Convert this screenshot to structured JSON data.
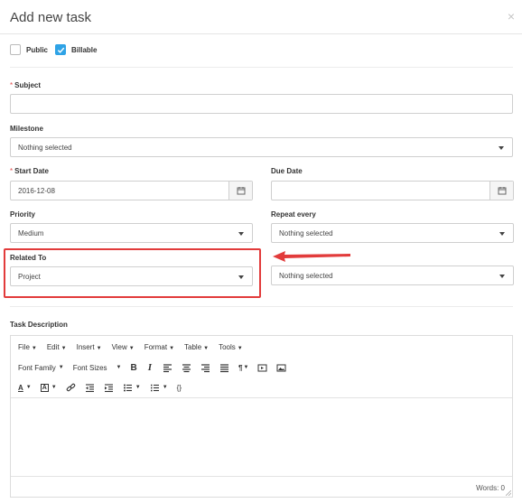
{
  "modal": {
    "title": "Add new task",
    "close": "×"
  },
  "options": {
    "public_label": "Public",
    "billable_label": "Billable",
    "public_checked": false,
    "billable_checked": true
  },
  "form": {
    "required_mark": "*",
    "subject_label": "Subject",
    "subject_value": "",
    "milestone_label": "Milestone",
    "milestone_value": "Nothing selected",
    "start_date_label": "Start Date",
    "start_date_value": "2016-12-08",
    "due_date_label": "Due Date",
    "due_date_value": "",
    "priority_label": "Priority",
    "priority_value": "Medium",
    "repeat_label": "Repeat every",
    "repeat_value": "Nothing selected",
    "related_label": "Related To",
    "related_value": "Project",
    "related_item_value": "Nothing selected",
    "description_label": "Task Description"
  },
  "editor": {
    "menus": [
      "File",
      "Edit",
      "Insert",
      "View",
      "Format",
      "Table",
      "Tools"
    ],
    "font_family": "Font Family",
    "font_sizes": "Font Sizes",
    "bold": "B",
    "italic": "I",
    "paragraph": "¶",
    "variables": "{}",
    "words": "Words: 0"
  },
  "colors": {
    "accent": "#2fa3e6",
    "highlight": "#e23b3b",
    "required": "#e34c4c"
  }
}
